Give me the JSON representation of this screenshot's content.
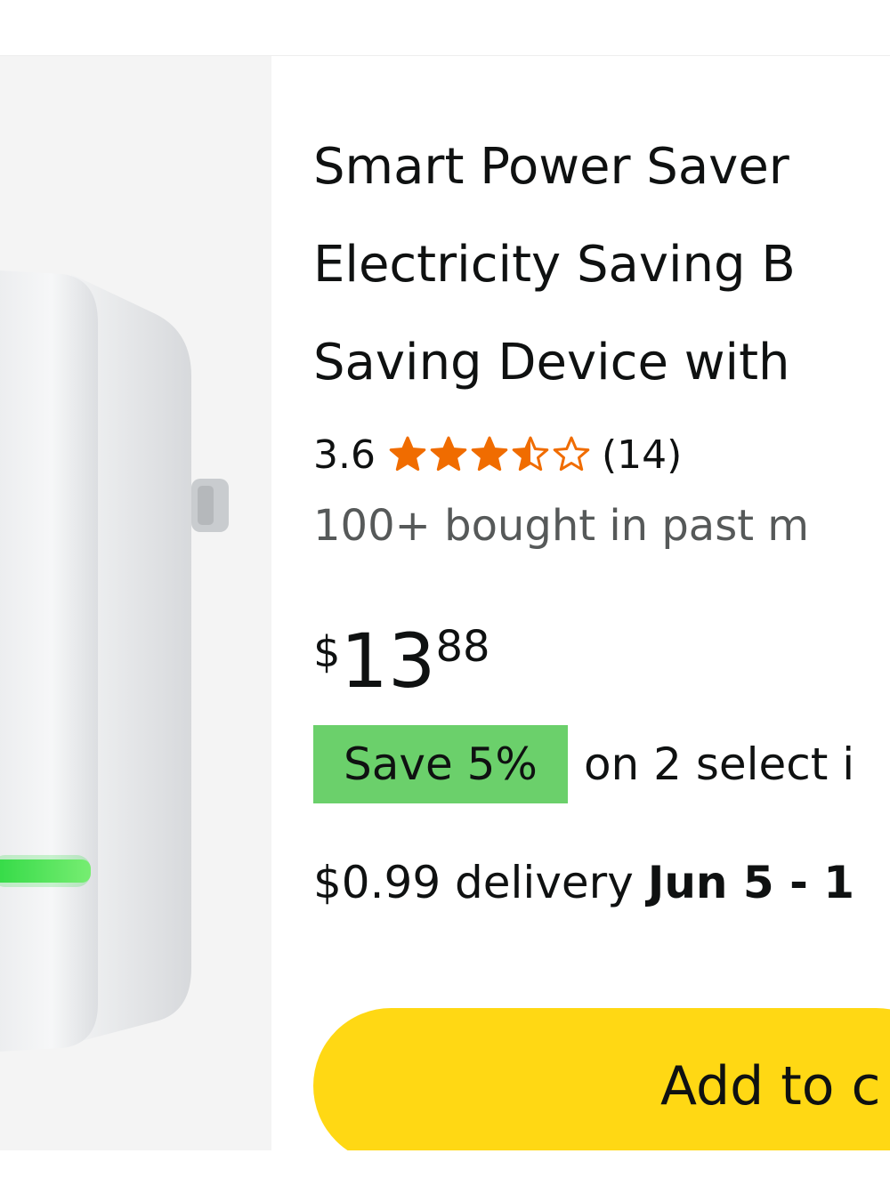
{
  "product": {
    "image_icon": "power-saver-plug-image",
    "title_lines": [
      "Smart Power Saver",
      "Electricity Saving B",
      "Saving Device with"
    ],
    "rating": {
      "value": "3.6",
      "stars": 3.6,
      "max_stars": 5,
      "count": "(14)"
    },
    "bought": "100+ bought in past m",
    "price": {
      "symbol": "$",
      "whole": "13",
      "fraction": "88"
    },
    "promo": {
      "badge": "Save 5%",
      "text": "on 2 select i"
    },
    "delivery": {
      "prefix": "$0.99 delivery ",
      "date": "Jun 5 - 1"
    },
    "add_to_cart_label": "Add to c"
  },
  "colors": {
    "star": "#f06c00",
    "save_badge": "#6bd06b",
    "add_to_cart": "#ffd814",
    "led": "#39e04a"
  }
}
